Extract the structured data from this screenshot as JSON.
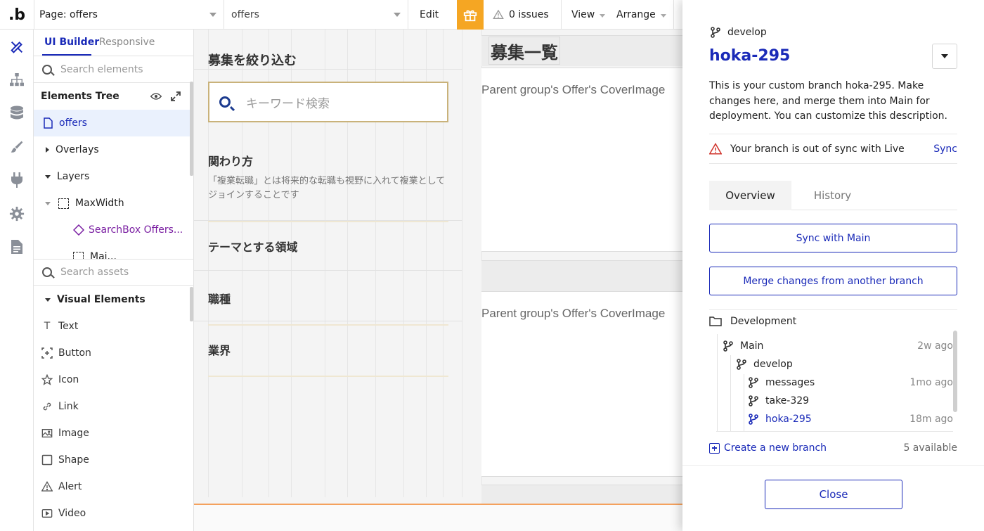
{
  "topbar": {
    "logo": ".b",
    "page_select": "Page: offers",
    "element_select": "offers",
    "edit_label": "Edit",
    "issues_label": "0 issues",
    "view_label": "View",
    "arrange_label": "Arrange"
  },
  "rail": {
    "icons": [
      "design-icon",
      "workflow-icon",
      "data-icon",
      "styles-icon",
      "plugins-icon",
      "settings-icon",
      "logs-icon"
    ]
  },
  "left_panel": {
    "tabs": [
      "UI Builder",
      "Responsive"
    ],
    "search_elements_placeholder": "Search elements",
    "tree_title": "Elements Tree",
    "tree": [
      {
        "label": "offers",
        "selected": true
      },
      {
        "label": "Overlays"
      },
      {
        "label": "Layers"
      },
      {
        "label": "MaxWidth"
      },
      {
        "label": "SearchBox Offers..."
      },
      {
        "label": "Mai..."
      }
    ],
    "search_assets_placeholder": "Search assets",
    "visual_elements_title": "Visual Elements",
    "visual_elements": [
      {
        "label": "Text",
        "icon": "text-icon"
      },
      {
        "label": "Button",
        "icon": "button-icon"
      },
      {
        "label": "Icon",
        "icon": "star-icon"
      },
      {
        "label": "Link",
        "icon": "link-icon"
      },
      {
        "label": "Image",
        "icon": "image-icon"
      },
      {
        "label": "Shape",
        "icon": "shape-icon"
      },
      {
        "label": "Alert",
        "icon": "alert-icon"
      },
      {
        "label": "Video",
        "icon": "video-icon"
      }
    ]
  },
  "canvas": {
    "filter_title": "募集を絞り込む",
    "keyword_placeholder": "キーワード検索",
    "involvement_heading": "関わり方",
    "involvement_desc": "「複業転職」とは将来的な転職も視野に入れて複業としてジョインすることです",
    "theme_heading": "テーマとする領域",
    "job_heading": "職種",
    "industry_heading": "業界",
    "list_title": "募集一覧",
    "card_placeholder": "Parent group's Offer's CoverImage"
  },
  "branch_panel": {
    "parent_branch": "develop",
    "title": "hoka-295",
    "description": "This is your custom branch hoka-295. Make changes here, and merge them into Main for deployment. You can customize this description.",
    "sync_warning": "Your branch is out of sync with Live",
    "sync_link": "Sync",
    "tabs": [
      "Overview",
      "History"
    ],
    "sync_main_button": "Sync with Main",
    "merge_button": "Merge changes from another branch",
    "development_label": "Development",
    "branches": [
      {
        "name": "Main",
        "time": "2w ago"
      },
      {
        "name": "develop",
        "time": ""
      },
      {
        "name": "messages",
        "time": "1mo ago"
      },
      {
        "name": "take-329",
        "time": ""
      },
      {
        "name": "hoka-295",
        "time": "18m ago",
        "current": true
      }
    ],
    "create_branch": "Create a new branch",
    "available": "5 available",
    "close_button": "Close",
    "accent_color": "#1a2ab8"
  }
}
